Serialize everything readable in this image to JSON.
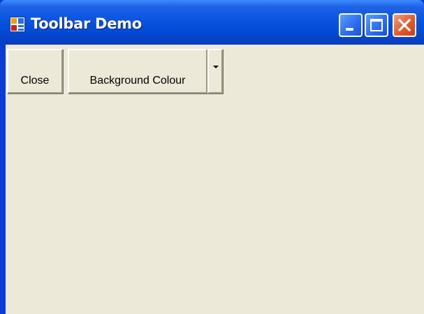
{
  "window": {
    "title": "Toolbar Demo",
    "icon": "app-window-icon",
    "controls": {
      "minimize": "minimize-icon",
      "maximize": "maximize-icon",
      "close": "close-icon"
    }
  },
  "toolbar": {
    "close_label": "Close",
    "background_label": "Background Colour",
    "dropdown_icon": "chevron-down-icon"
  },
  "colors": {
    "titlebar": "#0a54e0",
    "client_background": "#ece9d8",
    "close_button": "#e35a2c"
  }
}
